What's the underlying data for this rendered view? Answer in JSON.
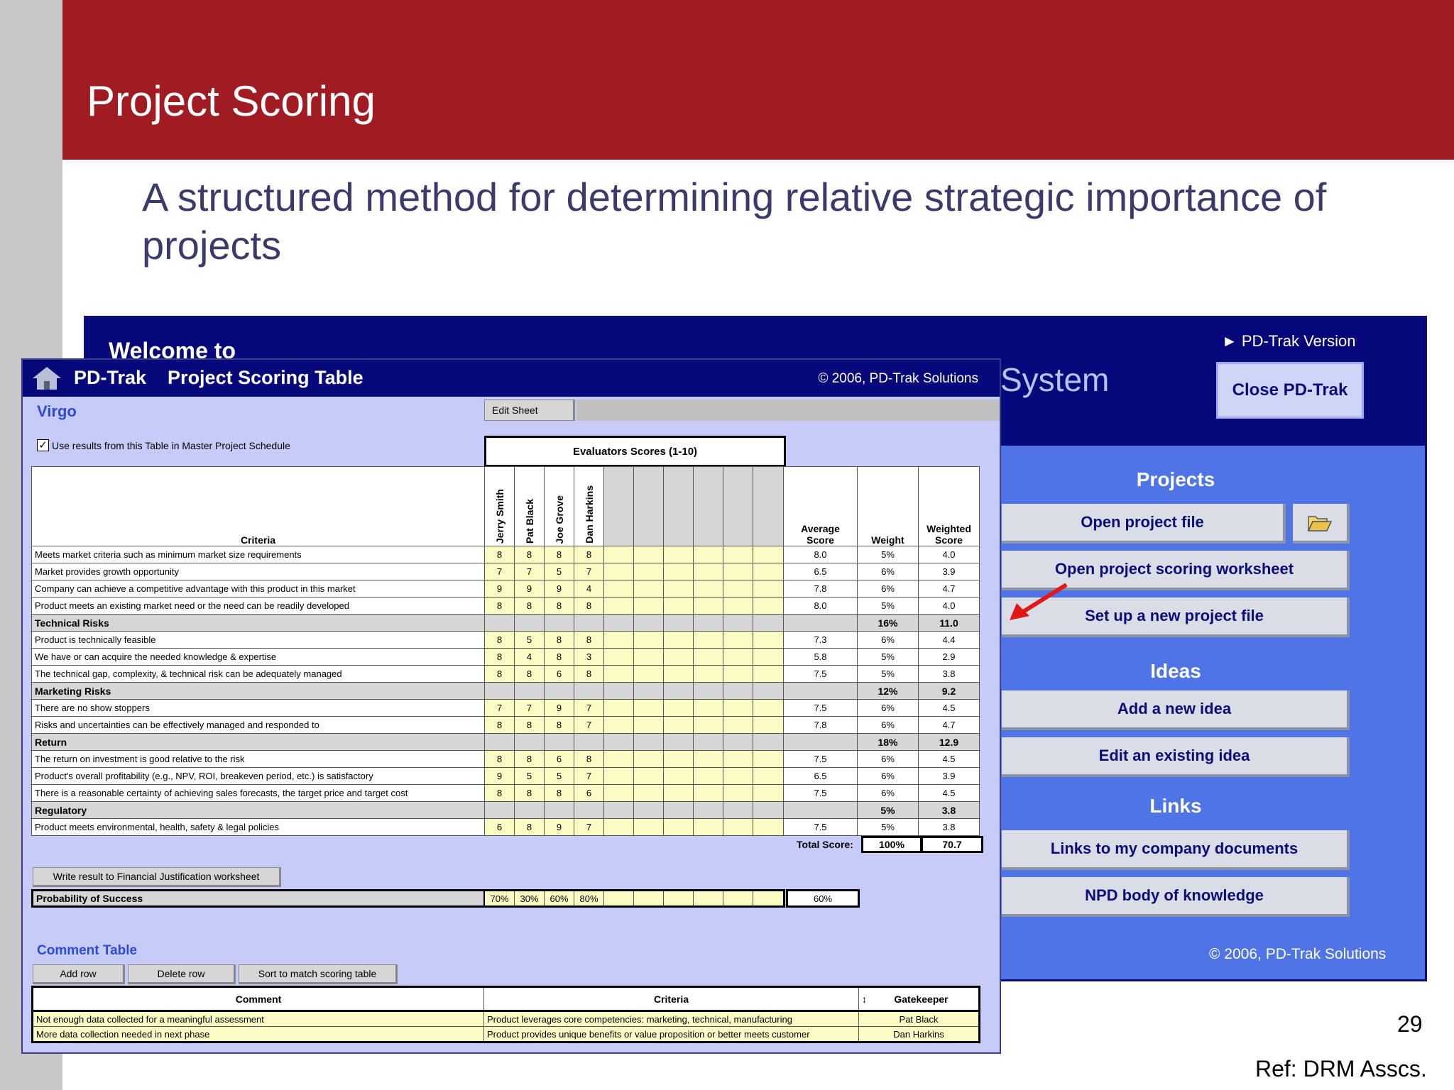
{
  "slide": {
    "title": "Project Scoring",
    "subtitle": "A structured method for determining relative strategic importance of projects",
    "page_number": "29",
    "reference": "Ref: DRM Asscs."
  },
  "welcome": {
    "welcome_to": "Welcome to",
    "system_text": "System",
    "version_link": "► PD-Trak Version",
    "close_button": "Close PD-Trak",
    "sections": {
      "projects": "Projects",
      "ideas": "Ideas",
      "links": "Links"
    },
    "buttons": {
      "open_project": "Open project file",
      "open_scoring": "Open project scoring worksheet",
      "new_project": "Set up a new project file",
      "add_idea": "Add a new idea",
      "edit_idea": "Edit an existing idea",
      "company_docs": "Links to my company documents",
      "npd_knowledge": "NPD body of knowledge"
    },
    "copyright": "© 2006, PD-Trak Solutions"
  },
  "scoring": {
    "title": "PD-Trak    Project Scoring Table",
    "copyright": "© 2006, PD-Trak Solutions",
    "project_name": "Virgo",
    "edit_sheet": "Edit Sheet",
    "use_results_checked": true,
    "use_results_label": "Use results from this Table in Master Project Schedule",
    "eval_header": "Evaluators Scores (1-10)",
    "headers": {
      "criteria": "Criteria",
      "average": "Average Score",
      "weight": "Weight",
      "weighted": "Weighted Score"
    },
    "evaluators": [
      "Jerry Smith",
      "Pat Black",
      "Joe Grove",
      "Dan Harkins"
    ],
    "rows": [
      {
        "label": "Meets market criteria such as minimum market size requirements",
        "scores": [
          "8",
          "8",
          "8",
          "8"
        ],
        "avg": "8.0",
        "weight": "5%",
        "weighted": "4.0",
        "group": false
      },
      {
        "label": "Market provides growth opportunity",
        "scores": [
          "7",
          "7",
          "5",
          "7"
        ],
        "avg": "6.5",
        "weight": "6%",
        "weighted": "3.9",
        "group": false
      },
      {
        "label": "Company can achieve a competitive advantage with this product in this market",
        "scores": [
          "9",
          "9",
          "9",
          "4"
        ],
        "avg": "7.8",
        "weight": "6%",
        "weighted": "4.7",
        "group": false
      },
      {
        "label": "Product meets an existing market need or the need can be readily developed",
        "scores": [
          "8",
          "8",
          "8",
          "8"
        ],
        "avg": "8.0",
        "weight": "5%",
        "weighted": "4.0",
        "group": false
      },
      {
        "label": "Technical Risks",
        "scores": [
          "",
          "",
          "",
          ""
        ],
        "avg": "",
        "weight": "16%",
        "weighted": "11.0",
        "group": true
      },
      {
        "label": "Product is technically feasible",
        "scores": [
          "8",
          "5",
          "8",
          "8"
        ],
        "avg": "7.3",
        "weight": "6%",
        "weighted": "4.4",
        "group": false
      },
      {
        "label": "We have or can acquire the needed knowledge & expertise",
        "scores": [
          "8",
          "4",
          "8",
          "3"
        ],
        "avg": "5.8",
        "weight": "5%",
        "weighted": "2.9",
        "group": false
      },
      {
        "label": "The technical gap, complexity, & technical risk can be adequately managed",
        "scores": [
          "8",
          "8",
          "6",
          "8"
        ],
        "avg": "7.5",
        "weight": "5%",
        "weighted": "3.8",
        "group": false
      },
      {
        "label": "Marketing Risks",
        "scores": [
          "",
          "",
          "",
          ""
        ],
        "avg": "",
        "weight": "12%",
        "weighted": "9.2",
        "group": true
      },
      {
        "label": "There are no show stoppers",
        "scores": [
          "7",
          "7",
          "9",
          "7"
        ],
        "avg": "7.5",
        "weight": "6%",
        "weighted": "4.5",
        "group": false
      },
      {
        "label": "Risks and uncertainties can be effectively managed and responded to",
        "scores": [
          "8",
          "8",
          "8",
          "7"
        ],
        "avg": "7.8",
        "weight": "6%",
        "weighted": "4.7",
        "group": false
      },
      {
        "label": "Return",
        "scores": [
          "",
          "",
          "",
          ""
        ],
        "avg": "",
        "weight": "18%",
        "weighted": "12.9",
        "group": true
      },
      {
        "label": "The return on investment is good relative to the risk",
        "scores": [
          "8",
          "8",
          "6",
          "8"
        ],
        "avg": "7.5",
        "weight": "6%",
        "weighted": "4.5",
        "group": false
      },
      {
        "label": "Product's overall profitability (e.g., NPV, ROI, breakeven period, etc.) is satisfactory",
        "scores": [
          "9",
          "5",
          "5",
          "7"
        ],
        "avg": "6.5",
        "weight": "6%",
        "weighted": "3.9",
        "group": false
      },
      {
        "label": "There is a reasonable certainty of achieving sales forecasts, the target price and  target cost",
        "scores": [
          "8",
          "8",
          "8",
          "6"
        ],
        "avg": "7.5",
        "weight": "6%",
        "weighted": "4.5",
        "group": false
      },
      {
        "label": "Regulatory",
        "scores": [
          "",
          "",
          "",
          ""
        ],
        "avg": "",
        "weight": "5%",
        "weighted": "3.8",
        "group": true
      },
      {
        "label": "Product meets environmental, health, safety & legal policies",
        "scores": [
          "6",
          "8",
          "9",
          "7"
        ],
        "avg": "7.5",
        "weight": "5%",
        "weighted": "3.8",
        "group": false
      }
    ],
    "total_label": "Total Score:",
    "total_weight": "100%",
    "total_score": "70.7",
    "write_result_button": "Write result to Financial Justification worksheet",
    "probability_label": "Probability of Success",
    "probabilities": [
      "70%",
      "30%",
      "60%",
      "80%"
    ],
    "probability_avg": "60%",
    "comment_title": "Comment Table",
    "comment_buttons": {
      "add": "Add row",
      "delete": "Delete row",
      "sort": "Sort to match scoring table"
    },
    "comment_headers": {
      "comment": "Comment",
      "criteria": "Criteria",
      "gatekeeper": "Gatekeeper"
    },
    "comments": [
      {
        "comment": "Not enough data collected for a meaningful assessment",
        "criteria": "Product leverages core competencies: marketing, technical, manufacturing",
        "gatekeeper": "Pat Black"
      },
      {
        "comment": "More data collection needed in next phase",
        "criteria": "Product provides unique benefits or value proposition or better meets customer",
        "gatekeeper": "Dan Harkins"
      }
    ]
  }
}
